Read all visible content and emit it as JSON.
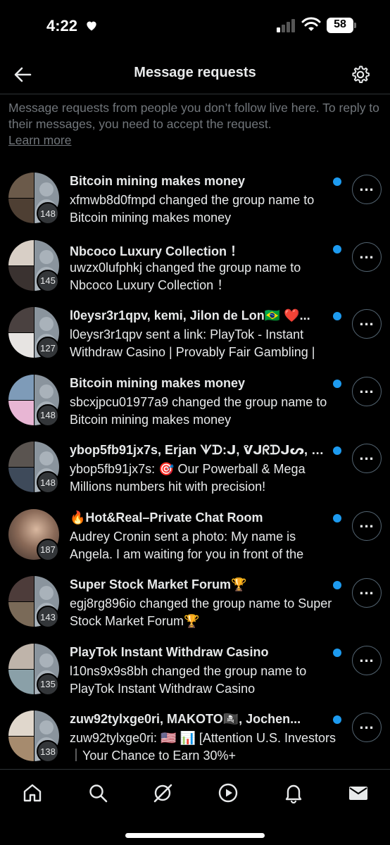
{
  "status_bar": {
    "time": "4:22",
    "battery": "58"
  },
  "header": {
    "title": "Message requests"
  },
  "info": {
    "text": "Message requests from people you don’t follow live here. To reply to their messages, you need to accept the request.",
    "learn_more": "Learn more"
  },
  "colors": {
    "accent": "#1d9bf0",
    "background": "#000000",
    "muted": "#71767b"
  },
  "requests": [
    {
      "title": "Bitcoin mining makes money",
      "preview": "xfmwb8d0fmpd changed the group name to Bitcoin mining makes money",
      "count": "148"
    },
    {
      "title": "Nbcoco Luxury Collection ！",
      "preview": "uwzx0lufphkj changed the group name to Nbcoco Luxury Collection ！",
      "count": "145"
    },
    {
      "title": "l0eysr3r1qpv, kemi, Jilon de Lon🇧🇷 ❤️...",
      "preview": "l0eysr3r1qpv sent a link: PlayTok - Instant Withdraw Casino | Provably Fair Gambling |",
      "count": "127"
    },
    {
      "title": "Bitcoin mining makes money",
      "preview": "sbcxjpcu01977a9 changed the group name to Bitcoin mining makes money",
      "count": "148"
    },
    {
      "title": "ybop5fb91jx7s, Erjan ᗐᗪ:ᒍ, ᕓᒍᖇᗪᒍᔕ, Ж...",
      "preview": "ybop5fb91jx7s: 🎯 Our Powerball & Mega Millions numbers hit with precision!",
      "count": "148"
    },
    {
      "title": "🔥Hot&Real–Private Chat Room",
      "preview": "Audrey Cronin sent a photo: My name is Angela. I am waiting for you in front of the",
      "count": "187"
    },
    {
      "title": "Super Stock Market Forum🏆",
      "preview": "egj8rg896io changed the group name to Super Stock Market Forum🏆",
      "count": "143"
    },
    {
      "title": "PlayTok Instant Withdraw Casino",
      "preview": "l10ns9x9s8bh changed the group name to PlayTok Instant Withdraw Casino",
      "count": "135"
    },
    {
      "title": "zuw92tylxge0ri, MAKOTO🏴‍☠️, Jochen...",
      "preview": "zuw92tylxge0ri: 🇺🇸 📊 [Attention U.S. Investors｜Your Chance to Earn 30%+",
      "count": "138"
    }
  ],
  "nav": [
    "home-icon",
    "search-icon",
    "grok-icon",
    "play-icon",
    "bell-icon",
    "mail-icon"
  ]
}
